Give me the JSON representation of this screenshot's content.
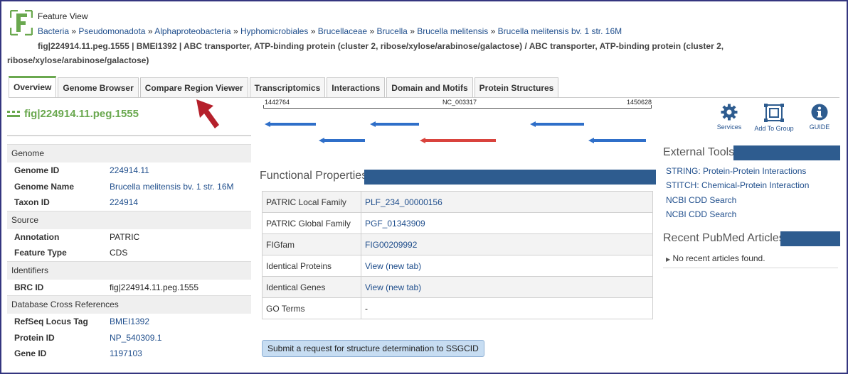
{
  "header": {
    "label": "Feature View",
    "breadcrumb": [
      "Bacteria",
      "Pseudomonadota",
      "Alphaproteobacteria",
      "Hyphomicrobiales",
      "Brucellaceae",
      "Brucella",
      "Brucella melitensis",
      "Brucella melitensis bv. 1 str. 16M"
    ],
    "breadcrumb_sep": "»",
    "title_line1": "fig|224914.11.peg.1555 | BMEI1392 | ABC transporter, ATP-binding protein (cluster 2, ribose/xylose/arabinose/galactose) / ABC transporter, ATP-binding protein (cluster 2,",
    "title_line2": "ribose/xylose/arabinose/galactose)"
  },
  "tabs": [
    "Overview",
    "Genome Browser",
    "Compare Region Viewer",
    "Transcriptomics",
    "Interactions",
    "Domain and Motifs",
    "Protein Structures"
  ],
  "feature_id": "fig|224914.11.peg.1555",
  "left_panel": {
    "sections": [
      {
        "title": "Genome",
        "rows": [
          {
            "key": "Genome ID",
            "value": "224914.11",
            "link": true
          },
          {
            "key": "Genome Name",
            "value": "Brucella melitensis bv. 1 str. 16M",
            "link": true
          },
          {
            "key": "Taxon ID",
            "value": "224914",
            "link": true
          }
        ]
      },
      {
        "title": "Source",
        "rows": [
          {
            "key": "Annotation",
            "value": "PATRIC",
            "link": false
          },
          {
            "key": "Feature Type",
            "value": "CDS",
            "link": false
          }
        ]
      },
      {
        "title": "Identifiers",
        "rows": [
          {
            "key": "BRC ID",
            "value": "fig|224914.11.peg.1555",
            "link": false
          }
        ]
      },
      {
        "title": "Database Cross References",
        "rows": [
          {
            "key": "RefSeq Locus Tag",
            "value": "BMEI1392",
            "link": true
          },
          {
            "key": "Protein ID",
            "value": "NP_540309.1",
            "link": true
          },
          {
            "key": "Gene ID",
            "value": "1197103",
            "link": true
          }
        ]
      }
    ]
  },
  "region_viewer": {
    "start": "1442764",
    "accession": "NC_003317",
    "end": "1450628",
    "colors": {
      "gene": "#2f6fc9",
      "focus": "#d9433d"
    }
  },
  "functional_properties": {
    "title": "Functional Properties",
    "rows": [
      {
        "key": "PATRIC Local Family",
        "value": "PLF_234_00000156",
        "link": true
      },
      {
        "key": "PATRIC Global Family",
        "value": "PGF_01343909",
        "link": true
      },
      {
        "key": "FIGfam",
        "value": "FIG00209992",
        "link": true
      },
      {
        "key": "Identical Proteins",
        "value": "View (new tab)",
        "link": true
      },
      {
        "key": "Identical Genes",
        "value": "View (new tab)",
        "link": true
      },
      {
        "key": "GO Terms",
        "value": "-",
        "link": false
      }
    ]
  },
  "ssgcid_button": "Submit a request for structure determination to SSGCID",
  "services": [
    {
      "label": "Services",
      "icon": "gear-icon"
    },
    {
      "label": "Add To Group",
      "icon": "add-to-group-icon"
    },
    {
      "label": "GUIDE",
      "icon": "info-icon"
    }
  ],
  "external_tools": {
    "title": "External Tools",
    "links": [
      "STRING: Protein-Protein Interactions",
      "STITCH: Chemical-Protein Interaction",
      "NCBI CDD Search",
      "NCBI CDD Search"
    ]
  },
  "pubmed": {
    "title": "Recent PubMed Articles",
    "empty": "No recent articles found."
  },
  "colors": {
    "accent_green": "#6aa84f",
    "bar_blue": "#2e5c8f",
    "link": "#1f4e8c",
    "arrow_red": "#b5202b"
  }
}
